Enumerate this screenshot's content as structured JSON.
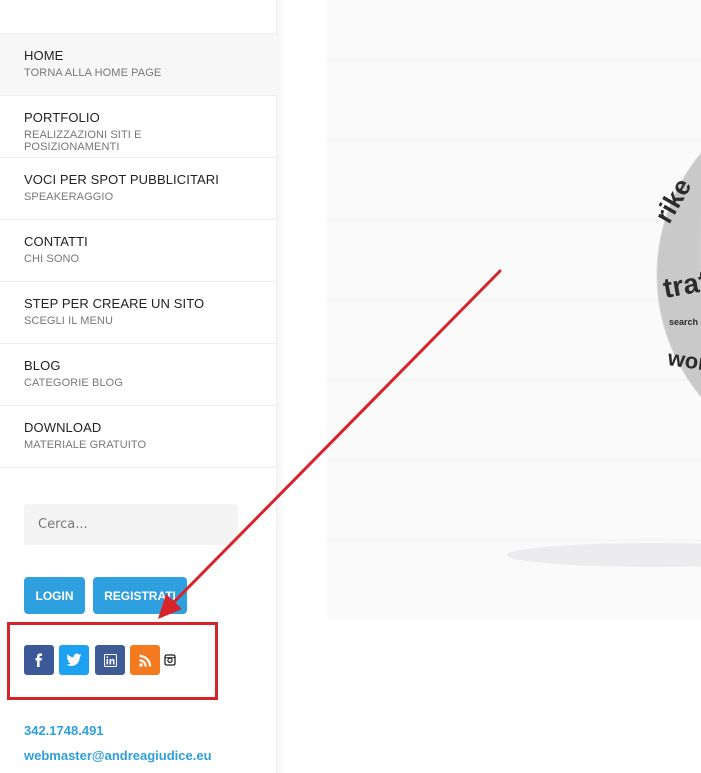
{
  "menu": [
    {
      "title": "HOME",
      "subtitle": "TORNA ALLA HOME PAGE"
    },
    {
      "title": "PORTFOLIO",
      "subtitle": "REALIZZAZIONI SITI E POSIZIONAMENTI"
    },
    {
      "title": "VOCI PER SPOT PUBBLICITARI",
      "subtitle": "SPEAKERAGGIO"
    },
    {
      "title": "CONTATTI",
      "subtitle": "CHI SONO"
    },
    {
      "title": "STEP PER CREARE UN SITO",
      "subtitle": "SCEGLI IL MENU"
    },
    {
      "title": "BLOG",
      "subtitle": "CATEGORIE BLOG"
    },
    {
      "title": "DOWNLOAD",
      "subtitle": "MATERIALE GRATUITO"
    }
  ],
  "search": {
    "placeholder": "Cerca..."
  },
  "auth": {
    "login_label": "LOGIN",
    "register_label": "REGISTRATI"
  },
  "social": {
    "icons": [
      "facebook-icon",
      "twitter-icon",
      "linkedin-icon",
      "rss-icon",
      "instagram-icon"
    ],
    "colors": {
      "facebook": "#3b5998",
      "twitter": "#1da1f2",
      "linkedin": "#3f5b95",
      "rss": "#f47a20"
    }
  },
  "contact": {
    "phone": "342.1748.491",
    "email": "webmaster@andreagiudice.eu"
  },
  "hero": {
    "words": [
      "rike",
      "traf",
      "search e",
      "wor"
    ]
  },
  "colors": {
    "accent": "#2e9fdf",
    "annotation": "#d8232a"
  }
}
